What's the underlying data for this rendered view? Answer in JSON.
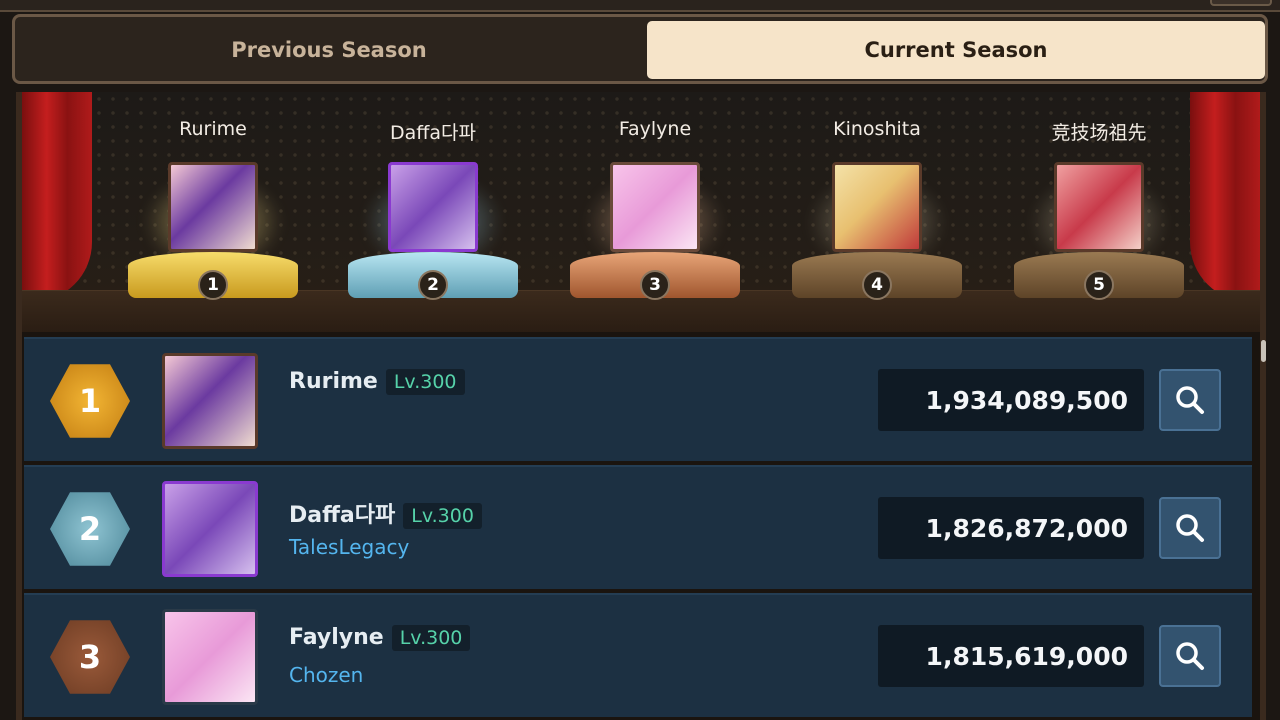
{
  "tabs": {
    "previous_label": "Previous Season",
    "current_label": "Current Season",
    "active": "current"
  },
  "podium": [
    {
      "rank": "1",
      "name": "Rurime",
      "base_color": "#e8c23a"
    },
    {
      "rank": "2",
      "name": "Daffa다파",
      "base_color": "#7fc4d8"
    },
    {
      "rank": "3",
      "name": "Faylyne",
      "base_color": "#c9744a"
    },
    {
      "rank": "4",
      "name": "Kinoshita",
      "base_color": "#8a6a44"
    },
    {
      "rank": "5",
      "name": "竞技场祖先",
      "base_color": "#8a6a44"
    }
  ],
  "rankings": [
    {
      "rank": "1",
      "name": "Rurime",
      "level": "Lv.300",
      "guild": "",
      "score": "1,934,089,500",
      "badge_color": "#e0a023"
    },
    {
      "rank": "2",
      "name": "Daffa다파",
      "level": "Lv.300",
      "guild": "TalesLegacy",
      "score": "1,826,872,000",
      "badge_color": "#5f9fb0"
    },
    {
      "rank": "3",
      "name": "Faylyne",
      "level": "Lv.300",
      "guild": "Chozen",
      "score": "1,815,619,000",
      "badge_color": "#8a4a30"
    }
  ],
  "icons": {
    "search": "magnifier-icon"
  }
}
